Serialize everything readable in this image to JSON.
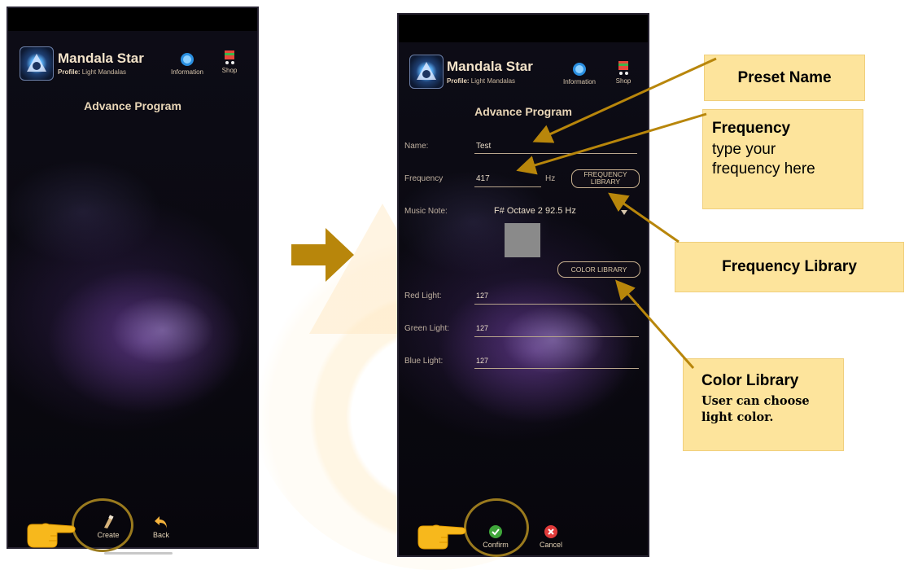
{
  "app": {
    "name": "Mandala Star",
    "profile_label": "Profile:",
    "profile_value": "Light Mandalas"
  },
  "header": {
    "information_label": "Information",
    "shop_label": "Shop"
  },
  "page_title": "Advance Program",
  "form": {
    "name_label": "Name:",
    "name_value": "Test",
    "frequency_label": "Frequency",
    "frequency_value": "417",
    "frequency_unit": "Hz",
    "frequency_library_label": "FREQUENCY LIBRARY",
    "music_note_label": "Music Note:",
    "music_note_value": "F# Octave 2 92.5 Hz",
    "color_library_label": "COLOR LIBRARY",
    "red_label": "Red Light:",
    "red_value": "127",
    "green_label": "Green Light:",
    "green_value": "127",
    "blue_label": "Blue Light:",
    "blue_value": "127",
    "swatch_color": "#8a8a8a"
  },
  "bottom_bar_left": {
    "create_label": "Create",
    "back_label": "Back"
  },
  "bottom_bar_right": {
    "confirm_label": "Confirm",
    "cancel_label": "Cancel"
  },
  "callouts": {
    "preset_name": "Preset Name",
    "frequency_title": "Frequency",
    "frequency_body_1": "type your",
    "frequency_body_2": "frequency here",
    "frequency_library": "Frequency Library",
    "color_library_title": "Color Library",
    "color_library_body_1": "User can choose",
    "color_library_body_2": "light color."
  },
  "colors": {
    "callout_bg": "#fde49c",
    "pointer": "#b8860b",
    "arrow": "#b8860b",
    "highlight_circle": "#9a7a1e"
  },
  "icons": [
    "mandala-logo-icon",
    "information-icon",
    "shop-cart-icon",
    "create-brush-icon",
    "back-arrow-icon",
    "confirm-check-icon",
    "cancel-x-icon",
    "pointing-hand-icon",
    "right-arrow-icon",
    "dropdown-caret-icon"
  ]
}
